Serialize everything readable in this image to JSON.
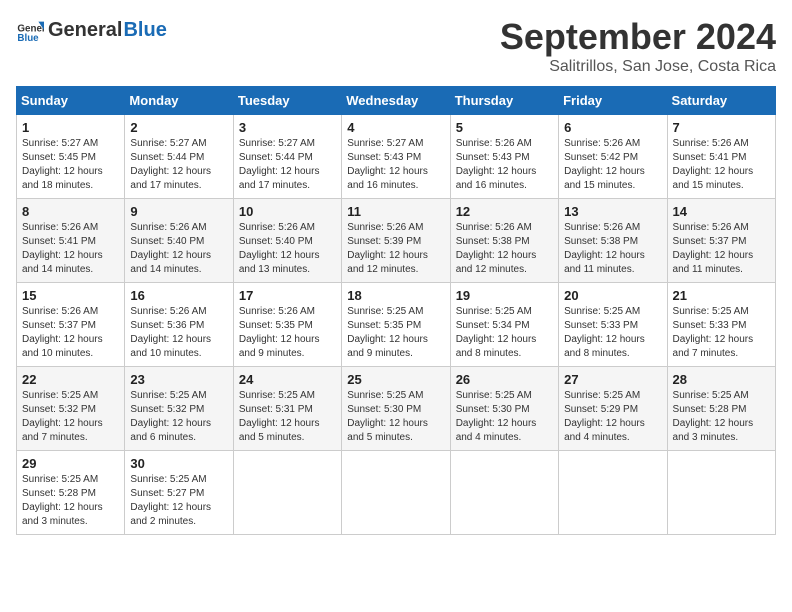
{
  "logo": {
    "general": "General",
    "blue": "Blue"
  },
  "title": "September 2024",
  "location": "Salitrillos, San Jose, Costa Rica",
  "days_of_week": [
    "Sunday",
    "Monday",
    "Tuesday",
    "Wednesday",
    "Thursday",
    "Friday",
    "Saturday"
  ],
  "weeks": [
    [
      {
        "day": "1",
        "sunrise": "5:27 AM",
        "sunset": "5:45 PM",
        "daylight": "12 hours and 18 minutes."
      },
      {
        "day": "2",
        "sunrise": "5:27 AM",
        "sunset": "5:44 PM",
        "daylight": "12 hours and 17 minutes."
      },
      {
        "day": "3",
        "sunrise": "5:27 AM",
        "sunset": "5:44 PM",
        "daylight": "12 hours and 17 minutes."
      },
      {
        "day": "4",
        "sunrise": "5:27 AM",
        "sunset": "5:43 PM",
        "daylight": "12 hours and 16 minutes."
      },
      {
        "day": "5",
        "sunrise": "5:26 AM",
        "sunset": "5:43 PM",
        "daylight": "12 hours and 16 minutes."
      },
      {
        "day": "6",
        "sunrise": "5:26 AM",
        "sunset": "5:42 PM",
        "daylight": "12 hours and 15 minutes."
      },
      {
        "day": "7",
        "sunrise": "5:26 AM",
        "sunset": "5:41 PM",
        "daylight": "12 hours and 15 minutes."
      }
    ],
    [
      {
        "day": "8",
        "sunrise": "5:26 AM",
        "sunset": "5:41 PM",
        "daylight": "12 hours and 14 minutes."
      },
      {
        "day": "9",
        "sunrise": "5:26 AM",
        "sunset": "5:40 PM",
        "daylight": "12 hours and 14 minutes."
      },
      {
        "day": "10",
        "sunrise": "5:26 AM",
        "sunset": "5:40 PM",
        "daylight": "12 hours and 13 minutes."
      },
      {
        "day": "11",
        "sunrise": "5:26 AM",
        "sunset": "5:39 PM",
        "daylight": "12 hours and 12 minutes."
      },
      {
        "day": "12",
        "sunrise": "5:26 AM",
        "sunset": "5:38 PM",
        "daylight": "12 hours and 12 minutes."
      },
      {
        "day": "13",
        "sunrise": "5:26 AM",
        "sunset": "5:38 PM",
        "daylight": "12 hours and 11 minutes."
      },
      {
        "day": "14",
        "sunrise": "5:26 AM",
        "sunset": "5:37 PM",
        "daylight": "12 hours and 11 minutes."
      }
    ],
    [
      {
        "day": "15",
        "sunrise": "5:26 AM",
        "sunset": "5:37 PM",
        "daylight": "12 hours and 10 minutes."
      },
      {
        "day": "16",
        "sunrise": "5:26 AM",
        "sunset": "5:36 PM",
        "daylight": "12 hours and 10 minutes."
      },
      {
        "day": "17",
        "sunrise": "5:26 AM",
        "sunset": "5:35 PM",
        "daylight": "12 hours and 9 minutes."
      },
      {
        "day": "18",
        "sunrise": "5:25 AM",
        "sunset": "5:35 PM",
        "daylight": "12 hours and 9 minutes."
      },
      {
        "day": "19",
        "sunrise": "5:25 AM",
        "sunset": "5:34 PM",
        "daylight": "12 hours and 8 minutes."
      },
      {
        "day": "20",
        "sunrise": "5:25 AM",
        "sunset": "5:33 PM",
        "daylight": "12 hours and 8 minutes."
      },
      {
        "day": "21",
        "sunrise": "5:25 AM",
        "sunset": "5:33 PM",
        "daylight": "12 hours and 7 minutes."
      }
    ],
    [
      {
        "day": "22",
        "sunrise": "5:25 AM",
        "sunset": "5:32 PM",
        "daylight": "12 hours and 7 minutes."
      },
      {
        "day": "23",
        "sunrise": "5:25 AM",
        "sunset": "5:32 PM",
        "daylight": "12 hours and 6 minutes."
      },
      {
        "day": "24",
        "sunrise": "5:25 AM",
        "sunset": "5:31 PM",
        "daylight": "12 hours and 5 minutes."
      },
      {
        "day": "25",
        "sunrise": "5:25 AM",
        "sunset": "5:30 PM",
        "daylight": "12 hours and 5 minutes."
      },
      {
        "day": "26",
        "sunrise": "5:25 AM",
        "sunset": "5:30 PM",
        "daylight": "12 hours and 4 minutes."
      },
      {
        "day": "27",
        "sunrise": "5:25 AM",
        "sunset": "5:29 PM",
        "daylight": "12 hours and 4 minutes."
      },
      {
        "day": "28",
        "sunrise": "5:25 AM",
        "sunset": "5:28 PM",
        "daylight": "12 hours and 3 minutes."
      }
    ],
    [
      {
        "day": "29",
        "sunrise": "5:25 AM",
        "sunset": "5:28 PM",
        "daylight": "12 hours and 3 minutes."
      },
      {
        "day": "30",
        "sunrise": "5:25 AM",
        "sunset": "5:27 PM",
        "daylight": "12 hours and 2 minutes."
      },
      null,
      null,
      null,
      null,
      null
    ]
  ]
}
